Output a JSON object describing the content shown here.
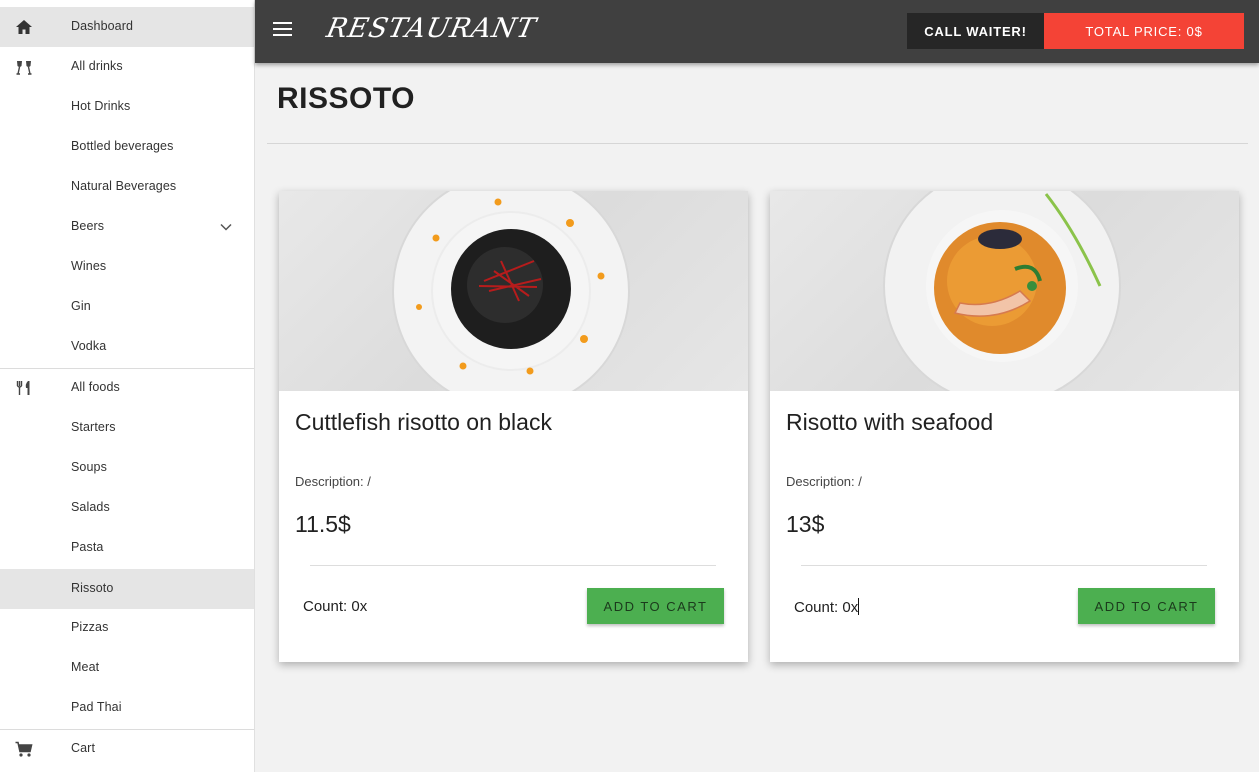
{
  "sidebar": {
    "items": [
      {
        "label": "Dashboard",
        "icon": "home-icon"
      },
      {
        "label": "All drinks",
        "icon": "glasses-icon"
      },
      {
        "label": "Hot Drinks"
      },
      {
        "label": "Bottled beverages"
      },
      {
        "label": "Natural Beverages"
      },
      {
        "label": "Beers",
        "icon": "chevron-down-icon"
      },
      {
        "label": "Wines"
      },
      {
        "label": "Gin"
      },
      {
        "label": "Vodka"
      },
      {
        "label": "All foods",
        "icon": "fork-knife-icon"
      },
      {
        "label": "Starters"
      },
      {
        "label": "Soups"
      },
      {
        "label": "Salads"
      },
      {
        "label": "Pasta"
      },
      {
        "label": "Rissoto"
      },
      {
        "label": "Pizzas"
      },
      {
        "label": "Meat"
      },
      {
        "label": "Pad Thai"
      },
      {
        "label": "Cart",
        "icon": "cart-icon"
      }
    ],
    "active": [
      "Dashboard",
      "Rissoto"
    ]
  },
  "header": {
    "brand": "RESTAURANT",
    "call_waiter": "CALL WAITER!",
    "total_price": "TOTAL PRICE: 0$",
    "colors": {
      "bar": "#404040",
      "waiter": "#262626",
      "total": "#f44336"
    }
  },
  "main": {
    "title": "RISSOTO",
    "cards": [
      {
        "name": "Cuttlefish risotto on black",
        "description": "Description: /",
        "price": "11.5$",
        "count": "Count: 0x",
        "add_label": "ADD TO CART",
        "image": "black-cuttlefish-risotto-plate"
      },
      {
        "name": "Risotto with seafood",
        "description": "Description: /",
        "price": "13$",
        "count": "Count: 0x",
        "add_label": "ADD TO CART",
        "image": "seafood-risotto-plate"
      }
    ],
    "accent": "#4caf50"
  }
}
